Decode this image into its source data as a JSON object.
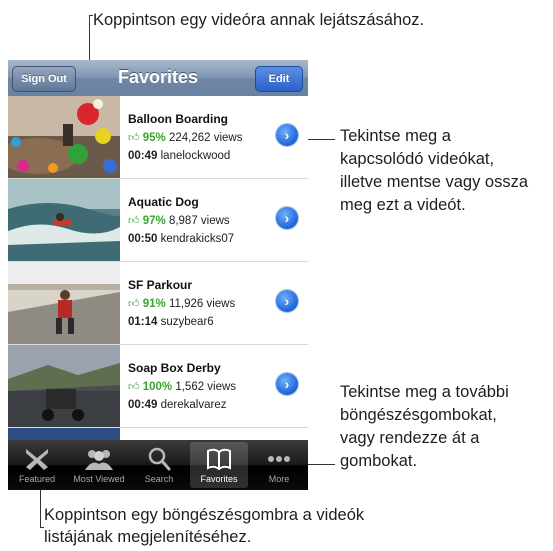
{
  "callouts": {
    "top": "Koppintson egy videóra annak lejátszásához.",
    "right_1": [
      "Tekintse meg a",
      "kapcsolódó videókat,",
      "illetve mentse vagy ossza",
      "meg ezt a videót."
    ],
    "right_2": [
      "Tekintse meg a további",
      "böngészésgombokat,",
      "vagy rendezze át a",
      "gombokat."
    ],
    "bottom": [
      "Koppintson egy böngészésgombra a videók",
      "listájának megjelenítéséhez."
    ]
  },
  "navbar": {
    "title": "Favorites",
    "sign_out": "Sign Out",
    "edit": "Edit"
  },
  "videos": [
    {
      "title": "Balloon Boarding",
      "rating": "95%",
      "views": "224,262 views",
      "duration": "00:49",
      "user": "lanelockwood"
    },
    {
      "title": "Aquatic Dog",
      "rating": "97%",
      "views": "8,987 views",
      "duration": "00:50",
      "user": "kendrakicks07"
    },
    {
      "title": "SF Parkour",
      "rating": "91%",
      "views": "11,926 views",
      "duration": "01:14",
      "user": "suzybear6"
    },
    {
      "title": "Soap Box Derby",
      "rating": "100%",
      "views": "1,562 views",
      "duration": "00:49",
      "user": "derekalvarez"
    }
  ],
  "tabs": [
    {
      "label": "Featured",
      "icon": "featured-x-icon",
      "selected": false
    },
    {
      "label": "Most Viewed",
      "icon": "people-icon",
      "selected": false
    },
    {
      "label": "Search",
      "icon": "search-icon",
      "selected": false
    },
    {
      "label": "Favorites",
      "icon": "book-icon",
      "selected": true
    },
    {
      "label": "More",
      "icon": "more-dots-icon",
      "selected": false
    }
  ],
  "colors": {
    "navbar": "#7f95b1",
    "edit_button": "#2a62c9",
    "rating_green": "#3aa32f",
    "tabbar": "#1a1a1a"
  }
}
